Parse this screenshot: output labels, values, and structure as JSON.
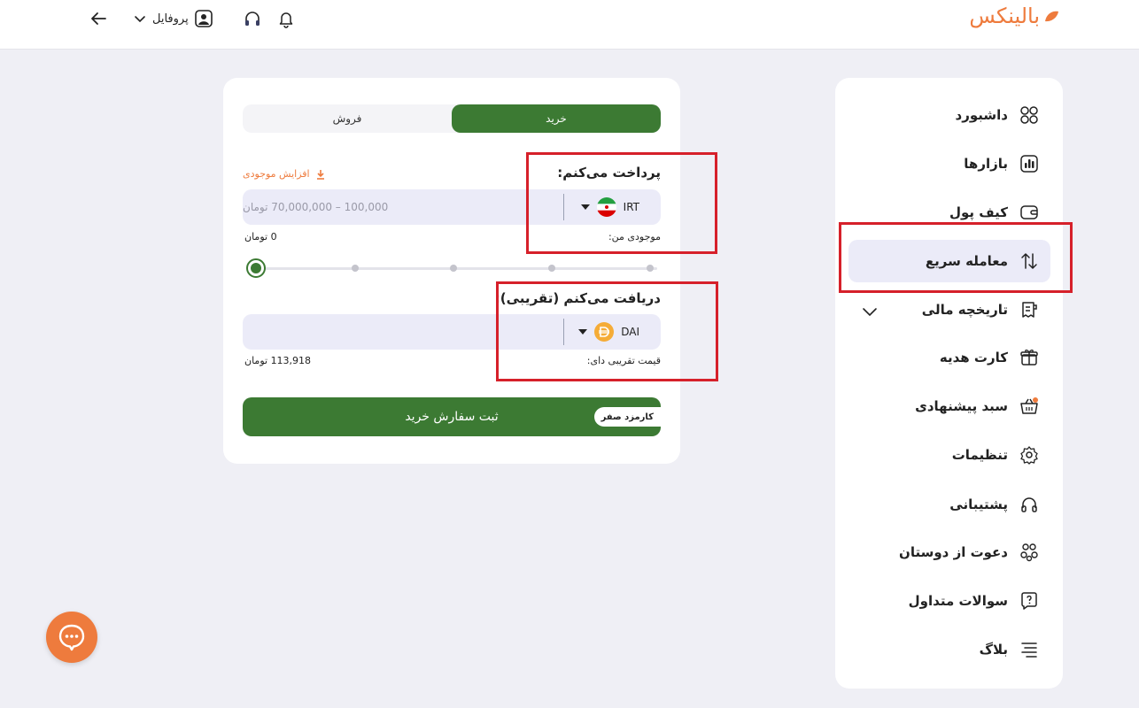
{
  "brand": {
    "name": "بالینکس",
    "color": "#ee7b3d"
  },
  "topbar": {
    "profile_label": "پروفایل",
    "icons": [
      "back-arrow-icon",
      "chevron-down-icon",
      "user-icon",
      "headphones-icon",
      "bell-icon"
    ]
  },
  "sidebar": {
    "items": [
      {
        "label": "داشبورد",
        "icon": "grid-icon"
      },
      {
        "label": "بازارها",
        "icon": "chart-icon"
      },
      {
        "label": "کیف پول",
        "icon": "wallet-icon"
      },
      {
        "label": "معامله سریع",
        "icon": "swap-icon",
        "active": true
      },
      {
        "label": "تاریخچه مالی",
        "icon": "receipt-icon"
      },
      {
        "label": "کارت هدیه",
        "icon": "gift-icon"
      },
      {
        "label": "سبد پیشنهادی",
        "icon": "basket-icon"
      },
      {
        "label": "تنظیمات",
        "icon": "gear-icon"
      },
      {
        "label": "پشتیبانی",
        "icon": "headphones-icon"
      },
      {
        "label": "دعوت از دوستان",
        "icon": "invite-icon"
      },
      {
        "label": "سوالات متداول",
        "icon": "faq-icon"
      },
      {
        "label": "بلاگ",
        "icon": "blog-icon"
      }
    ]
  },
  "trade": {
    "tab_buy": "خرید",
    "tab_sell": "فروش",
    "pay_title": "پرداخت می‌کنم:",
    "topup_label": "افزایش موجودی",
    "pay_currency": "IRT",
    "pay_placeholder": "100,000 – 70,000,000 تومان",
    "balance_label": "موجودی من:",
    "balance_value": "0 تومان",
    "slider_percent": 0,
    "receive_title": "دریافت می‌کنم (تقریبی):",
    "receive_currency": "DAI",
    "price_label": "قیمت تقریبی دای:",
    "price_value": "113,918 تومان",
    "submit_label": "ثبت سفارش خرید",
    "fee_badge": "کارمزد صفر"
  },
  "colors": {
    "primary_green": "#3c7a33",
    "accent_orange": "#ee7b3d",
    "highlight_red": "#d6202a"
  }
}
